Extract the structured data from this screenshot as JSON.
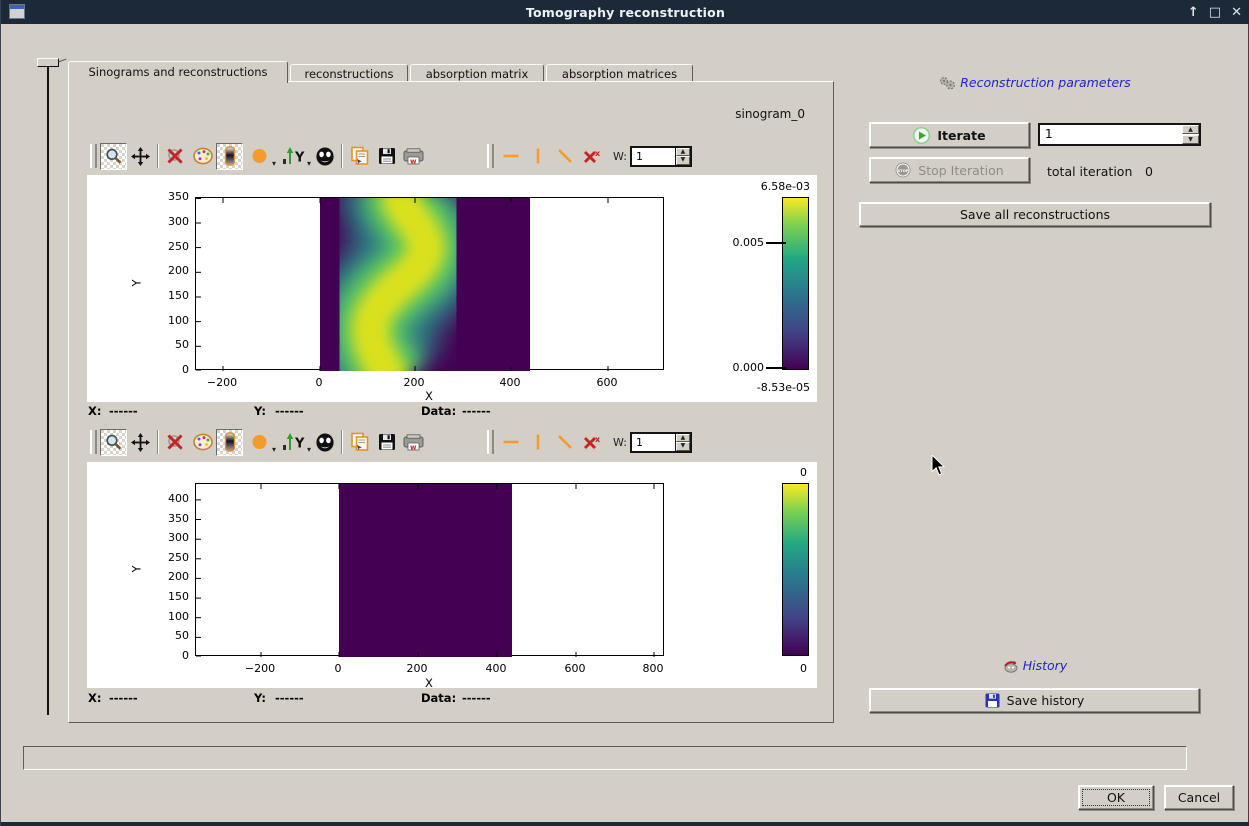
{
  "window": {
    "title": "Tomography reconstruction",
    "controls": {
      "shade": "↑",
      "maximize": "□",
      "close": "✕"
    }
  },
  "tabs": [
    {
      "label": "Sinograms and reconstructions",
      "active": true
    },
    {
      "label": "reconstructions",
      "active": false
    },
    {
      "label": "absorption matrix",
      "active": false
    },
    {
      "label": "absorption matrices",
      "active": false
    }
  ],
  "page": {
    "dataset_label": "sinogram_0"
  },
  "toolbar": {
    "w_label": "W:",
    "w_value": "1"
  },
  "plots": [
    {
      "xlabel": "X",
      "ylabel": "Y",
      "xticks": [
        "−200",
        "0",
        "200",
        "400",
        "600"
      ],
      "yticks": [
        "350",
        "300",
        "250",
        "200",
        "150",
        "100",
        "50",
        "0"
      ],
      "colorbar": {
        "max": "6.58e-03",
        "tick_upper": "0.005",
        "tick_lower": "0.000",
        "min": "-8.53e-05",
        "colormap": "viridis"
      },
      "image": {
        "type": "heatmap",
        "x_extent": [
          0,
          440
        ],
        "y_extent": [
          0,
          360
        ],
        "value_range": [
          -8.53e-05,
          0.00658
        ],
        "description": "sinogram with sinusoidal bright band"
      },
      "status": {
        "x_label": "X:",
        "x_value": "------",
        "y_label": "Y:",
        "y_value": "------",
        "data_label": "Data:",
        "data_value": "------"
      }
    },
    {
      "xlabel": "X",
      "ylabel": "Y",
      "xticks": [
        "−200",
        "0",
        "200",
        "400",
        "600",
        "800"
      ],
      "yticks": [
        "400",
        "350",
        "300",
        "250",
        "200",
        "150",
        "100",
        "50",
        "0"
      ],
      "colorbar": {
        "max": "0",
        "min": "0",
        "colormap": "viridis"
      },
      "image": {
        "type": "heatmap",
        "x_extent": [
          0,
          440
        ],
        "y_extent": [
          0,
          443
        ],
        "value_range": [
          0,
          0
        ],
        "description": "uniform zero reconstruction"
      },
      "status": {
        "x_label": "X:",
        "x_value": "------",
        "y_label": "Y:",
        "y_value": "------",
        "data_label": "Data:",
        "data_value": "------"
      }
    }
  ],
  "right_panel": {
    "parameters_title": "Reconstruction parameters",
    "iterate_label": "Iterate",
    "iterations_value": "1",
    "stop_label": "Stop Iteration",
    "total_iteration_label": "total iteration",
    "total_iteration_value": "0",
    "save_all_label": "Save all reconstructions",
    "history_title": "History",
    "save_history_label": "Save history"
  },
  "footer": {
    "ok_label": "OK",
    "cancel_label": "Cancel"
  },
  "colors": {
    "titlebar": "#1b2939",
    "dialog_bg": "#d3cfc7",
    "link_blue": "#2323cd",
    "accent_orange": "#f39b2d",
    "viridis_bottom": "#440154",
    "viridis_mid": "#21918c",
    "viridis_top": "#fde725"
  }
}
